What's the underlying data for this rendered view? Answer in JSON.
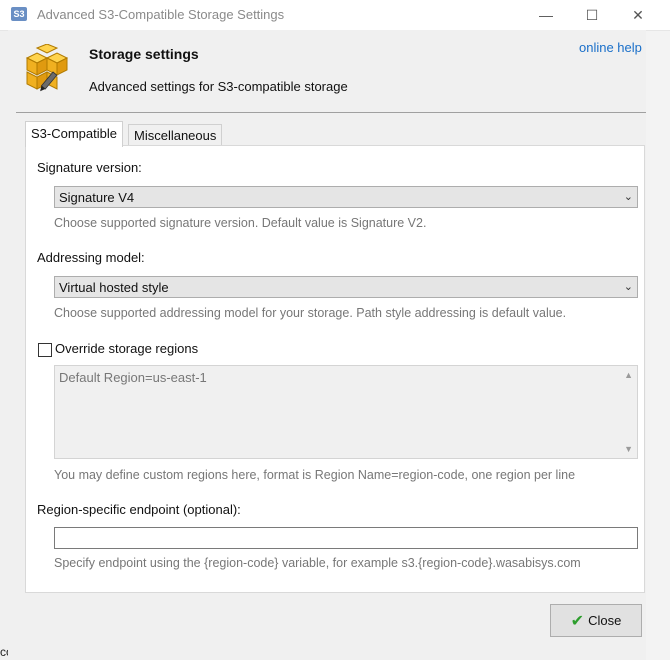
{
  "window": {
    "icon_text": "S3",
    "title": "Advanced S3-Compatible Storage Settings",
    "minimize_glyph": "—",
    "maximize_glyph": "☐",
    "close_glyph": "✕"
  },
  "header": {
    "title": "Storage settings",
    "subtitle": "Advanced settings for S3-compatible storage",
    "help_link": "online help",
    "logo_icon": "storage-boxes-pencil-icon"
  },
  "tabs": [
    {
      "label": "S3-Compatible",
      "active": true
    },
    {
      "label": "Miscellaneous",
      "active": false
    }
  ],
  "signature": {
    "label": "Signature version:",
    "value": "Signature V4",
    "hint": "Choose supported signature version. Default value is Signature V2."
  },
  "addressing": {
    "label": "Addressing model:",
    "value": "Virtual hosted style",
    "hint": "Choose supported addressing model for your storage. Path style addressing is default value."
  },
  "regions": {
    "checkbox_label": "Override storage regions",
    "checked": false,
    "textarea_value": "Default Region=us-east-1",
    "hint": "You may define custom regions here, format is Region Name=region-code, one region per line"
  },
  "endpoint": {
    "label": "Region-specific endpoint (optional):",
    "value": "",
    "hint": "Specify endpoint using the {region-code} variable, for example s3.{region-code}.wasabisys.com"
  },
  "footer": {
    "close_label": "Close",
    "close_icon": "check-icon"
  },
  "background": {
    "bottom_fragment": "configurati"
  },
  "colors": {
    "link": "#1a6fc9",
    "check": "#2e9e2e",
    "icon_box": "#f0b020"
  }
}
